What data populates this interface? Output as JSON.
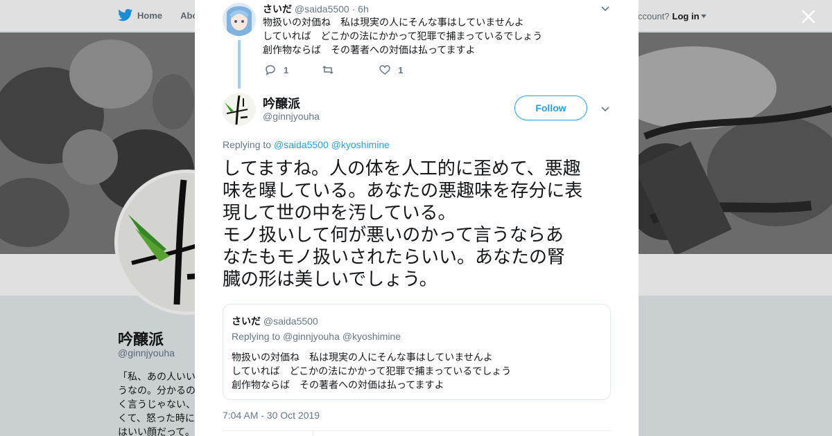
{
  "background": {
    "nav": {
      "home_label": "Home",
      "about_label": "Abo",
      "account_prompt": "ccount?",
      "login_label": "Log in"
    },
    "profile": {
      "name": "吟醸派",
      "handle": "@ginnjyouha",
      "bio_lines": [
        "「私、あの人いい",
        "うなの。分かるの",
        "く言うじゃない、",
        "くて、怒った時に",
        "はいい顔だって。"
      ]
    }
  },
  "modal": {
    "previous_tweet": {
      "name": "さいだ",
      "handle": "@saida5500",
      "separator": "·",
      "time": "6h",
      "lines": [
        "物扱いの対価ね　私は現実の人にそんな事はしていませんよ",
        "していれば　どこかの法にかかって犯罪で捕まっているでしょう",
        "創作物ならば　その著者への対価は払ってますよ"
      ],
      "reply_count": "1",
      "retweet_count": "",
      "like_count": "1"
    },
    "main_tweet": {
      "name": "吟醸派",
      "handle": "@ginnjyouha",
      "follow_label": "Follow",
      "replying_prefix": "Replying to",
      "replying_to": [
        "@saida5500",
        "@kyoshimine"
      ],
      "lines": [
        "してますね。人の体を人工的に歪めて、悪趣",
        "味を曝している。あなたの悪趣味を存分に表",
        "現して世の中を汚している。",
        "モノ扱いして何が悪いのかって言うならあ",
        "なたもモノ扱いされたらいい。あなたの腎",
        "臓の形は美しいでしょう。"
      ],
      "timestamp": "7:04 AM - 30 Oct 2019"
    },
    "quoted_tweet": {
      "name": "さいだ",
      "handle": "@saida5500",
      "replying_prefix": "Replying to",
      "replying_to": [
        "@ginnjyouha",
        "@kyoshimine"
      ],
      "lines": [
        "物扱いの対価ね　私は現実の人にそんな事はしていませんよ",
        "していれば　どこかの法にかかって犯罪で捕まっているでしょう",
        "創作物ならば　その著者への対価は払ってますよ"
      ]
    }
  },
  "colors": {
    "accent": "#1da1f2",
    "thread_line": "#9fd0f2",
    "muted": "#657786",
    "text": "#14171a"
  },
  "icons": [
    "twitter-bird-icon",
    "close-icon",
    "chevron-down-icon",
    "reply-icon",
    "retweet-icon",
    "heart-icon"
  ]
}
